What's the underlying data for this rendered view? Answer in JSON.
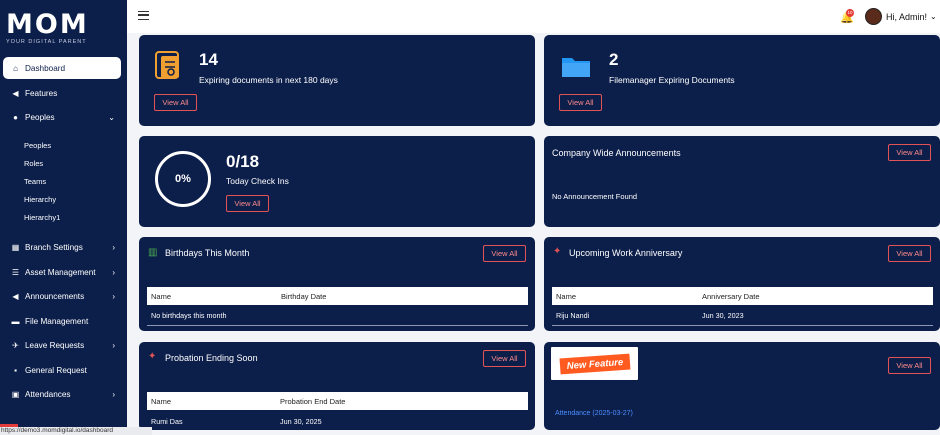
{
  "brand": {
    "logo": "MOM",
    "tagline": "YOUR DIGITAL PARENT"
  },
  "status_url": "https://demo3.momdigital.io/dashboard",
  "header": {
    "greeting": "Hi, Admin!",
    "notification_count": "10"
  },
  "sidebar": {
    "items": [
      {
        "label": "Dashboard",
        "icon": "home-icon"
      },
      {
        "label": "Features",
        "icon": "megaphone-icon"
      },
      {
        "label": "Peoples",
        "icon": "users-icon"
      },
      {
        "label": "Branch Settings",
        "icon": "building-icon"
      },
      {
        "label": "Asset Management",
        "icon": "list-icon"
      },
      {
        "label": "Announcements",
        "icon": "megaphone-icon"
      },
      {
        "label": "File Management",
        "icon": "folder-icon"
      },
      {
        "label": "Leave Requests",
        "icon": "plane-icon"
      },
      {
        "label": "General Request",
        "icon": "request-icon"
      },
      {
        "label": "Attendances",
        "icon": "calendar-icon"
      }
    ],
    "sub_items": [
      "Peoples",
      "Roles",
      "Teams",
      "Hierarchy",
      "Hierarchy1"
    ]
  },
  "cards": {
    "expiring_docs": {
      "count": "14",
      "label": "Expiring documents in next 180 days",
      "button": "View All"
    },
    "filemanager": {
      "count": "2",
      "label": "Filemanager Expiring Documents",
      "button": "View All"
    },
    "checkins": {
      "count": "0/18",
      "label": "Today Check Ins",
      "percent": "0%",
      "button": "View All"
    },
    "announcements": {
      "title": "Company Wide Announcements",
      "empty": "No Announcement Found",
      "button": "View All"
    },
    "birthdays": {
      "title": "Birthdays This Month",
      "button": "View All",
      "columns": [
        "Name",
        "Birthday Date"
      ],
      "empty": "No birthdays this month"
    },
    "anniversary": {
      "title": "Upcoming Work Anniversary",
      "button": "View All",
      "columns": [
        "Name",
        "Anniversary Date"
      ],
      "rows": [
        [
          "Riju Nandi",
          "Jun 30, 2023"
        ]
      ]
    },
    "probation": {
      "title": "Probation Ending Soon",
      "button": "View All",
      "columns": [
        "Name",
        "Probation End Date"
      ],
      "rows": [
        [
          "Rumi Das",
          "Jun 30, 2025"
        ]
      ]
    },
    "new_feature": {
      "badge": "New Feature",
      "button": "View All",
      "link": "Attendance (2025-03-27)"
    }
  },
  "colors": {
    "navy": "#0c1e4a",
    "accent": "#e25454",
    "badge": "#ff5a1f"
  }
}
